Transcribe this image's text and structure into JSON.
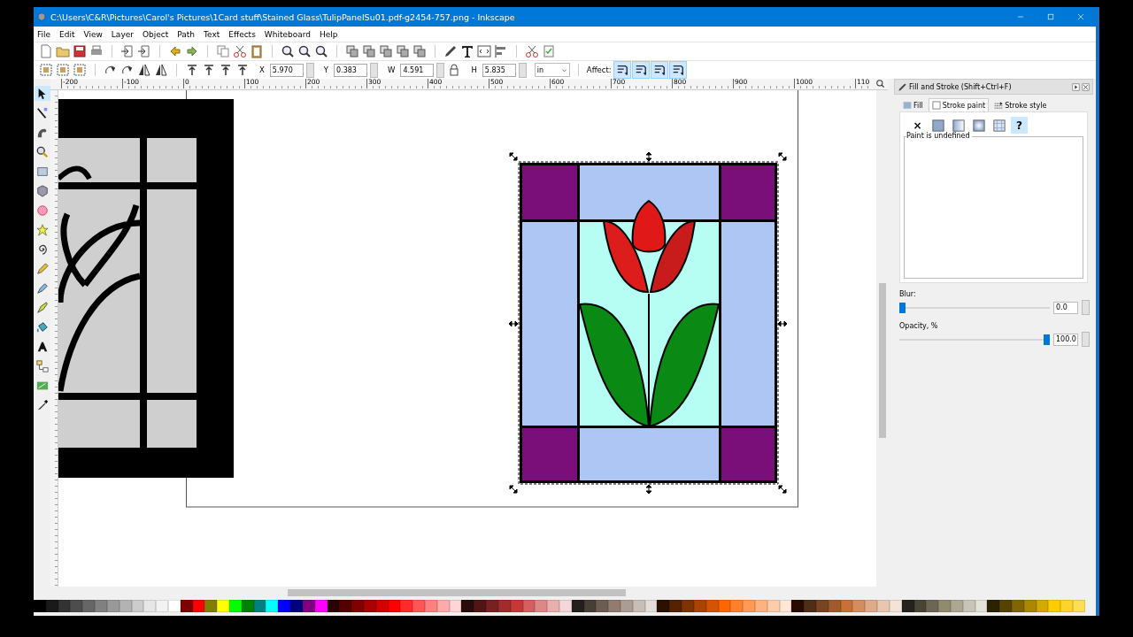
{
  "window": {
    "title": "C:\\Users\\C&R\\Pictures\\Carol's Pictures\\1Card stuff\\Stained Glass\\TulipPanelSu01.pdf-g2454-757.png - Inkscape"
  },
  "menu": [
    {
      "label": "File"
    },
    {
      "label": "Edit"
    },
    {
      "label": "View"
    },
    {
      "label": "Layer"
    },
    {
      "label": "Object"
    },
    {
      "label": "Path"
    },
    {
      "label": "Text"
    },
    {
      "label": "Effects"
    },
    {
      "label": "Whiteboard"
    },
    {
      "label": "Help"
    }
  ],
  "selector_toolbar": {
    "fields": [
      {
        "label": "X",
        "value": "5.970"
      },
      {
        "label": "Y",
        "value": "0.383"
      },
      {
        "label": "W",
        "value": "4.591"
      },
      {
        "label": "H",
        "value": "5.835"
      }
    ],
    "unit": "in",
    "affect_label": "Affect:",
    "affect_toggles": [
      {
        "selected": true
      },
      {
        "selected": true
      },
      {
        "selected": true
      },
      {
        "selected": true
      }
    ]
  },
  "toolbox": {
    "tools": [
      {
        "kind": "select",
        "selected": true
      },
      {
        "kind": "node",
        "selected": false
      },
      {
        "kind": "tweak",
        "selected": false
      },
      {
        "kind": "zoom",
        "selected": false
      },
      {
        "kind": "rect",
        "selected": false
      },
      {
        "kind": "box",
        "selected": false
      },
      {
        "kind": "ellipse",
        "selected": false
      },
      {
        "kind": "star",
        "selected": false
      },
      {
        "kind": "spiral",
        "selected": false
      },
      {
        "kind": "pencil",
        "selected": false
      },
      {
        "kind": "pen",
        "selected": false
      },
      {
        "kind": "calligraphy",
        "selected": false
      },
      {
        "kind": "bucket",
        "selected": false
      },
      {
        "kind": "text",
        "selected": false
      },
      {
        "kind": "connector",
        "selected": false
      },
      {
        "kind": "gradient",
        "selected": false
      },
      {
        "kind": "dropper",
        "selected": false
      }
    ]
  },
  "ruler": {
    "labels": [
      "-200",
      "-100",
      "0",
      "100",
      "200",
      "300",
      "400",
      "500",
      "600",
      "700",
      "800",
      "900",
      "1000",
      "110"
    ]
  },
  "fill_and_stroke": {
    "title": "Fill and Stroke (Shift+Ctrl+F)",
    "tabs": [
      {
        "label": "Fill",
        "selected": false
      },
      {
        "label": "Stroke paint",
        "selected": true
      },
      {
        "label": "Stroke style",
        "selected": false
      }
    ],
    "paint_modes": [
      {
        "kind": "none",
        "label": "×",
        "selected": false
      },
      {
        "kind": "flat",
        "selected": false
      },
      {
        "kind": "linear",
        "selected": false
      },
      {
        "kind": "radial",
        "selected": false
      },
      {
        "kind": "pattern",
        "selected": false
      },
      {
        "kind": "unset",
        "label": "?",
        "selected": true
      }
    ],
    "frame_label": "Paint is undefined",
    "blur": {
      "label": "Blur:",
      "level": 0,
      "value": "0.0"
    },
    "opacity": {
      "label": "Opacity, %",
      "level": 1,
      "value": "100.0"
    }
  },
  "palette": {
    "swatches": [
      {
        "color": "#000000"
      },
      {
        "color": "#1a1a1a"
      },
      {
        "color": "#333333"
      },
      {
        "color": "#4d4d4d"
      },
      {
        "color": "#666666"
      },
      {
        "color": "#808080"
      },
      {
        "color": "#999999"
      },
      {
        "color": "#b3b3b3"
      },
      {
        "color": "#cccccc"
      },
      {
        "color": "#e6e6e6"
      },
      {
        "color": "#f2f2f2"
      },
      {
        "color": "#ffffff"
      },
      {
        "color": "#800000"
      },
      {
        "color": "#ff0000"
      },
      {
        "color": "#808000"
      },
      {
        "color": "#ffff00"
      },
      {
        "color": "#00ff00"
      },
      {
        "color": "#008000"
      },
      {
        "color": "#008080"
      },
      {
        "color": "#00ffff"
      },
      {
        "color": "#0000ff"
      },
      {
        "color": "#000080"
      },
      {
        "color": "#800080"
      },
      {
        "color": "#ff00ff"
      },
      {
        "color": "#2b0000"
      },
      {
        "color": "#550000"
      },
      {
        "color": "#800000"
      },
      {
        "color": "#aa0000"
      },
      {
        "color": "#d40000"
      },
      {
        "color": "#ff0000"
      },
      {
        "color": "#ff2a2a"
      },
      {
        "color": "#ff5555"
      },
      {
        "color": "#ff8080"
      },
      {
        "color": "#ffaaaa"
      },
      {
        "color": "#ffd5d5"
      },
      {
        "color": "#280b0b"
      },
      {
        "color": "#501616"
      },
      {
        "color": "#782121"
      },
      {
        "color": "#a02c2c"
      },
      {
        "color": "#c83737"
      },
      {
        "color": "#d35f5f"
      },
      {
        "color": "#de8787"
      },
      {
        "color": "#e9afaf"
      },
      {
        "color": "#f4d7d7"
      },
      {
        "color": "#241f1c"
      },
      {
        "color": "#483e37"
      },
      {
        "color": "#6c5d53"
      },
      {
        "color": "#917c6f"
      },
      {
        "color": "#ac9d93"
      },
      {
        "color": "#c8beb7"
      },
      {
        "color": "#e3dedb"
      },
      {
        "color": "#2b1100"
      },
      {
        "color": "#552200"
      },
      {
        "color": "#803300"
      },
      {
        "color": "#aa4400"
      },
      {
        "color": "#d45500"
      },
      {
        "color": "#ff6600"
      },
      {
        "color": "#ff7f2a"
      },
      {
        "color": "#ff9955"
      },
      {
        "color": "#ffb380"
      },
      {
        "color": "#ffccaa"
      },
      {
        "color": "#ffe6d5"
      },
      {
        "color": "#280b00"
      },
      {
        "color": "#502d16"
      },
      {
        "color": "#784421"
      },
      {
        "color": "#a05a2c"
      },
      {
        "color": "#c87137"
      },
      {
        "color": "#d38d5f"
      },
      {
        "color": "#deaa87"
      },
      {
        "color": "#e9c6af"
      },
      {
        "color": "#f4e3d7"
      },
      {
        "color": "#24221c"
      },
      {
        "color": "#484537"
      },
      {
        "color": "#6c6753"
      },
      {
        "color": "#918a6f"
      },
      {
        "color": "#aca793"
      },
      {
        "color": "#c8c4b7"
      },
      {
        "color": "#e3e2db"
      },
      {
        "color": "#2b2200"
      },
      {
        "color": "#554400"
      },
      {
        "color": "#806600"
      },
      {
        "color": "#aa8800"
      },
      {
        "color": "#d4aa00"
      },
      {
        "color": "#ffcc00"
      },
      {
        "color": "#ffd42a"
      },
      {
        "color": "#ffdd55"
      }
    ]
  }
}
